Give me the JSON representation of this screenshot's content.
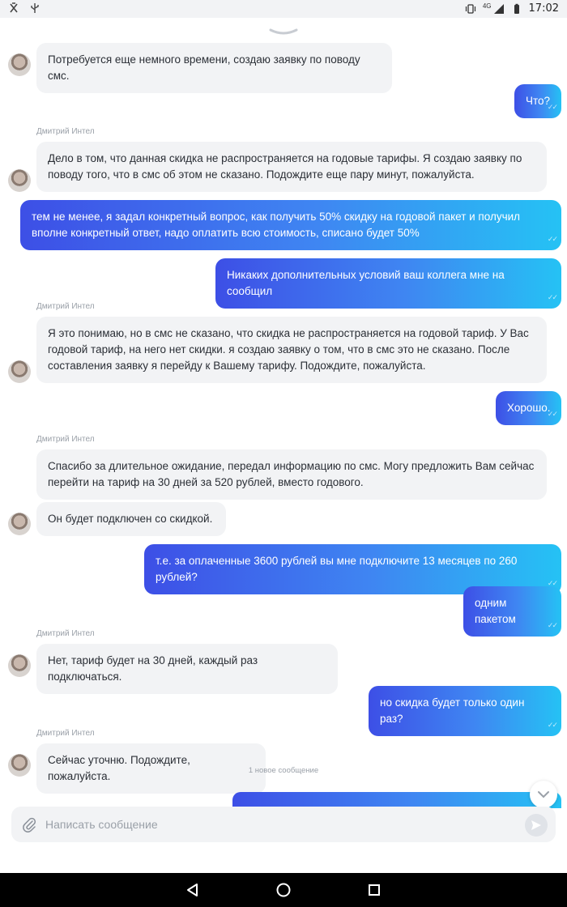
{
  "status_bar": {
    "time": "17:02",
    "network": "4G",
    "left_icons": [
      "usb-debug-icon",
      "usb-icon"
    ],
    "right_icons": [
      "vibrate-icon",
      "signal-icon",
      "battery-icon"
    ]
  },
  "sender_name": "Дмитрий Интел",
  "messages": [
    {
      "dir": "in",
      "text": "Потребуется еще немного времени, создаю заявку по поводу смс."
    },
    {
      "dir": "out",
      "text": "Что?"
    },
    {
      "dir": "in",
      "sender": "Дмитрий Интел",
      "lines": [
        "Дело в том, что данная скидка не распространяется на годовые тарифы. Я создаю заявку по",
        "поводу того, что в смс об этом не сказано. Подождите еще пару минут, пожалуйста."
      ]
    },
    {
      "dir": "out",
      "lines": [
        "тем не менее, я задал конкретный вопрос, как получить 50% скидку на годовой пакет и получил",
        "вполне конкретный ответ, надо оплатить всю стоимость, списано будет 50%"
      ]
    },
    {
      "dir": "out",
      "text": "Никаких дополнительных условий ваш коллега мне на сообщил"
    },
    {
      "dir": "in",
      "sender": "Дмитрий Интел",
      "lines": [
        "Я это понимаю, но в смс не сказано, что скидка не распространяется на годовой тариф. У Вас",
        "годовой тариф, на него нет скидки. я создаю заявку о том, что в смс это не сказано. После",
        "составления заявку я перейду к Вашему тарифу. Подождите, пожалуйста."
      ]
    },
    {
      "dir": "out",
      "text": "Хорошо."
    },
    {
      "dir": "in",
      "sender": "Дмитрий Интел",
      "lines": [
        "Спасибо за длительное ожидание, передал информацию по смс. Могу предложить Вам сейчас",
        "перейти на тариф на 30 дней за 520 рублей, вместо годового."
      ]
    },
    {
      "dir": "in",
      "text": "Он будет подключен со скидкой."
    },
    {
      "dir": "out",
      "text": "т.е. за оплаченные 3600 рублей вы мне подключите 13 месяцев по 260 рублей?"
    },
    {
      "dir": "out",
      "text": "одним пакетом"
    },
    {
      "dir": "in",
      "sender": "Дмитрий Интел",
      "text": "Нет, тариф будет на 30 дней, каждый раз подключаться."
    },
    {
      "dir": "out",
      "text": "но скидка будет только один раз?"
    },
    {
      "dir": "in",
      "sender": "Дмитрий Интел",
      "text": "Сейчас уточню. Подождите, пожалуйста."
    }
  ],
  "new_messages_label": "1 новое сообщение",
  "composer": {
    "placeholder": "Написать сообщение",
    "value": ""
  },
  "colors": {
    "outgoing_gradient_start": "#3d4fe6",
    "outgoing_gradient_end": "#25c2f4",
    "incoming_bubble": "#f2f3f5",
    "sender_name": "#9aa0a8"
  }
}
